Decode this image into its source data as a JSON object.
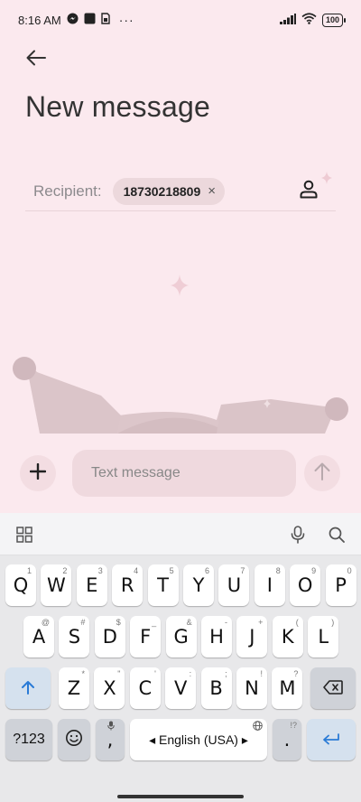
{
  "status_bar": {
    "time": "8:16 AM",
    "notification_icons": [
      "messenger-icon",
      "app-square-icon",
      "sim-icon"
    ],
    "more": "···",
    "battery": "100"
  },
  "header": {
    "back_icon": "arrow-left-icon",
    "title": "New message"
  },
  "recipient": {
    "label": "Recipient:",
    "chips": [
      {
        "number": "18730218809",
        "remove": "×"
      }
    ],
    "contact_icon": "person-icon"
  },
  "compose": {
    "add_icon": "plus-icon",
    "placeholder": "Text message",
    "value": "",
    "send_icon": "arrow-up-icon"
  },
  "keyboard": {
    "toolbar_icons": [
      "grid-icon",
      "mic-icon",
      "search-icon"
    ],
    "row1": [
      {
        "k": "Q",
        "h": "1"
      },
      {
        "k": "W",
        "h": "2"
      },
      {
        "k": "E",
        "h": "3"
      },
      {
        "k": "R",
        "h": "4"
      },
      {
        "k": "T",
        "h": "5"
      },
      {
        "k": "Y",
        "h": "6"
      },
      {
        "k": "U",
        "h": "7"
      },
      {
        "k": "I",
        "h": "8"
      },
      {
        "k": "O",
        "h": "9"
      },
      {
        "k": "P",
        "h": "0"
      }
    ],
    "row2": [
      {
        "k": "A",
        "h": "@"
      },
      {
        "k": "S",
        "h": "#"
      },
      {
        "k": "D",
        "h": "$"
      },
      {
        "k": "F",
        "h": "_"
      },
      {
        "k": "G",
        "h": "&"
      },
      {
        "k": "H",
        "h": "-"
      },
      {
        "k": "J",
        "h": "+"
      },
      {
        "k": "K",
        "h": "("
      },
      {
        "k": "L",
        "h": ")"
      }
    ],
    "row3": [
      {
        "k": "Z",
        "h": "*"
      },
      {
        "k": "X",
        "h": "\""
      },
      {
        "k": "C",
        "h": "'"
      },
      {
        "k": "V",
        "h": ":"
      },
      {
        "k": "B",
        "h": ";"
      },
      {
        "k": "N",
        "h": "!"
      },
      {
        "k": "M",
        "h": "?"
      }
    ],
    "shift_icon": "shift-arrow-icon",
    "backspace_icon": "backspace-icon",
    "symbols_label": "?123",
    "emoji_icon": "emoji-icon",
    "comma": ",",
    "comma_hint": "🎤",
    "space_label": "◂ English (USA) ▸",
    "globe_hint": "globe-icon",
    "period": ".",
    "period_hint": "!?",
    "enter_icon": "enter-icon"
  }
}
